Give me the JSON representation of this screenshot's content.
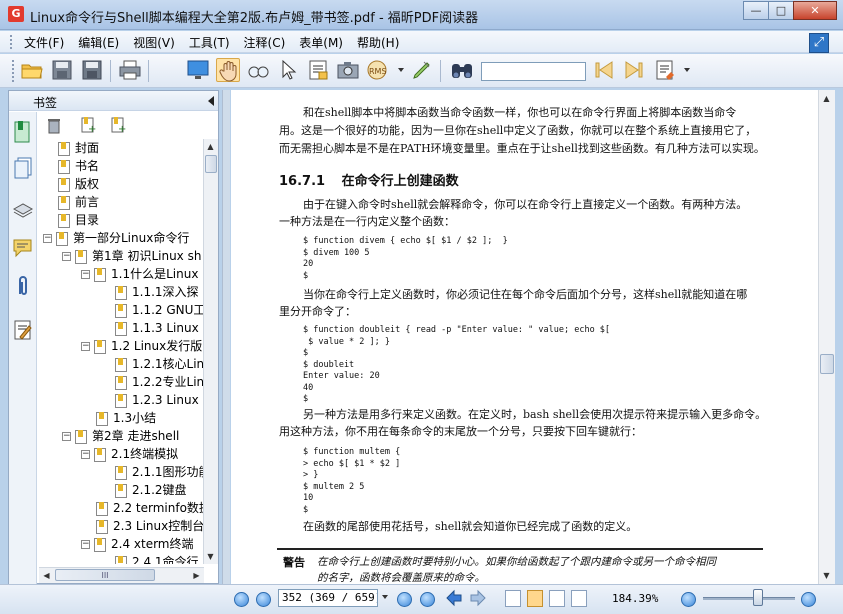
{
  "window": {
    "title": "Linux命令行与Shell脚本编程大全第2版.布卢姆_带书签.pdf - 福昕PDF阅读器",
    "app_icon_glyph": "G",
    "controls": {
      "minimize": "—",
      "maximize": "□",
      "close": "✕"
    }
  },
  "menu": {
    "items": [
      "文件(F)",
      "编辑(E)",
      "视图(V)",
      "工具(T)",
      "注释(C)",
      "表单(M)",
      "帮助(H)"
    ]
  },
  "toolbar": {
    "buttons": [
      "open-folder",
      "save",
      "save-as",
      "print",
      "fullscreen",
      "hand-tool",
      "zoom-tool",
      "select-tool",
      "text-select",
      "snapshot",
      "rms",
      "pen-tool",
      "find"
    ],
    "active": "hand-tool",
    "search_value": ""
  },
  "bookmarks_panel": {
    "title": "书签",
    "tree": [
      {
        "label": "封面",
        "level": 0
      },
      {
        "label": "书名",
        "level": 0
      },
      {
        "label": "版权",
        "level": 0
      },
      {
        "label": "前言",
        "level": 0
      },
      {
        "label": "目录",
        "level": 0
      },
      {
        "label": "第一部分Linux命令行",
        "level": 0,
        "expanded": true
      },
      {
        "label": "第1章  初识Linux sh",
        "level": 1,
        "expanded": true
      },
      {
        "label": "1.1什么是Linux",
        "level": 2,
        "expanded": true
      },
      {
        "label": "1.1.1深入探",
        "level": 3
      },
      {
        "label": "1.1.2  GNU工",
        "level": 3
      },
      {
        "label": "1.1.3  Linux",
        "level": 3
      },
      {
        "label": "1.2 Linux发行版",
        "level": 2,
        "expanded": true
      },
      {
        "label": "1.2.1核心Lin",
        "level": 3
      },
      {
        "label": "1.2.2专业Lin",
        "level": 3
      },
      {
        "label": "1.2.3  Linux",
        "level": 3
      },
      {
        "label": "1.3小结",
        "level": 2
      },
      {
        "label": "第2章  走进shell",
        "level": 1,
        "expanded": true
      },
      {
        "label": "2.1终端模拟",
        "level": 2,
        "expanded": true
      },
      {
        "label": "2.1.1图形功能",
        "level": 3
      },
      {
        "label": "2.1.2键盘",
        "level": 3
      },
      {
        "label": "2.2 terminfo数据",
        "level": 2
      },
      {
        "label": "2.3 Linux控制台",
        "level": 2
      },
      {
        "label": "2.4 xterm终端",
        "level": 2,
        "expanded": true
      },
      {
        "label": "2.4.1命令行",
        "level": 3
      }
    ],
    "hscroll_label": "III"
  },
  "document": {
    "intro_lines": [
      "和在shell脚本中将脚本函数当命令函数一样，你也可以在命令行界面上将脚本函数当命令",
      "用。这是一个很好的功能，因为一旦你在shell中定义了函数，你就可以在整个系统上直接用它了，",
      "而无需担心脚本是不是在PATH环境变量里。重点在于让shell找到这些函数。有几种方法可以实现。"
    ],
    "section_number": "16.7.1",
    "section_title": "在命令行上创建函数",
    "p1_lines": [
      "由于在键入命令时shell就会解释命令，你可以在命令行上直接定义一个函数。有两种方法。",
      "一种方法是在一行内定义整个函数："
    ],
    "code1": "$ function divem { echo $[ $1 / $2 ];  }\n$ divem 100 5\n20\n$",
    "p2_lines": [
      "当你在命令行上定义函数时，你必须记住在每个命令后面加个分号，这样shell就能知道在哪",
      "里分开命令了："
    ],
    "code2": "$ function doubleit { read -p \"Enter value: \" value; echo $[\n $ value * 2 ]; }\n$\n$ doubleit\nEnter value: 20\n40\n$",
    "p3_lines": [
      "另一种方法是用多行来定义函数。在定义时，bash shell会使用次提示符来提示输入更多命令。",
      "用这种方法，你不用在每条命令的末尾放一个分号，只要按下回车键就行："
    ],
    "code3": "$ function multem {\n> echo $[ $1 * $2 ]\n> }\n$ multem 2 5\n10\n$",
    "p4_line": "在函数的尾部使用花括号，shell就会知道你已经完成了函数的定义。",
    "note_label": "警告",
    "note_lines": [
      "在命令行上创建函数时要特别小心。如果你给函数起了个跟内建命令或另一个命令相同",
      "的名字，函数将会覆盖原来的命令。"
    ]
  },
  "statusbar": {
    "page_display": "352 (369 / 659)",
    "zoom": "184.39%",
    "zoom_fraction": 0.6
  },
  "colors": {
    "titlebar": "#b9d1ea",
    "accent": "#2f76c7",
    "active_tool": "#ffe3a8"
  }
}
